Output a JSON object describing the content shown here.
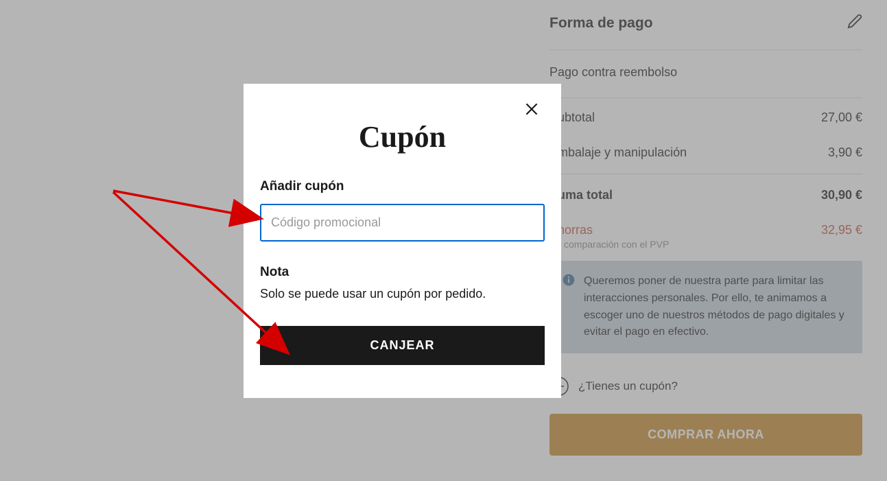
{
  "sidebar": {
    "payment_title": "Forma de pago",
    "payment_method": "Pago contra reembolso",
    "subtotal_label": "Subtotal",
    "subtotal_value": "27,00 €",
    "handling_label": "Embalaje y manipulación",
    "handling_value": "3,90 €",
    "total_label": "Suma total",
    "total_value": "30,90 €",
    "savings_label": "Ahorras",
    "savings_value": "32,95 €",
    "savings_note": "En comparación con el PVP",
    "info_text": "Queremos poner de nuestra parte para limitar las interacciones personales. Por ello, te animamos a escoger uno de nuestros métodos de pago digitales y evitar el pago en efectivo.",
    "coupon_link": "¿Tienes un cupón?",
    "buy_button": "COMPRAR AHORA"
  },
  "modal": {
    "title": "Cupón",
    "add_label": "Añadir cupón",
    "placeholder": "Código promocional",
    "note_label": "Nota",
    "note_text": "Solo se puede usar un cupón por pedido.",
    "button": "CANJEAR"
  }
}
